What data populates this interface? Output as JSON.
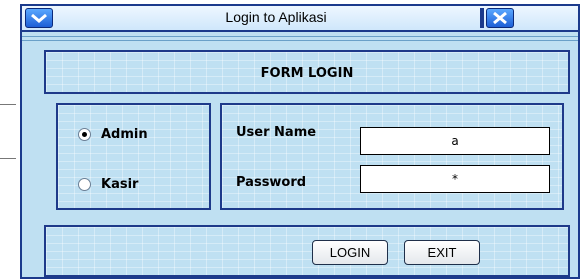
{
  "window": {
    "title": "Login to Aplikasi"
  },
  "form": {
    "header": "FORM LOGIN"
  },
  "roles": {
    "selected": "Admin",
    "options": [
      {
        "label": "Admin",
        "selected": true
      },
      {
        "label": "Kasir",
        "selected": false
      }
    ]
  },
  "fields": {
    "username": {
      "label": "User Name",
      "value": "a"
    },
    "password": {
      "label": "Password",
      "value": "*"
    }
  },
  "buttons": {
    "login": "LOGIN",
    "exit": "EXIT"
  },
  "colors": {
    "panel_bg": "#bfe0f2",
    "border": "#1e3a8a",
    "titlebar_icon": "#1d5fd6"
  }
}
